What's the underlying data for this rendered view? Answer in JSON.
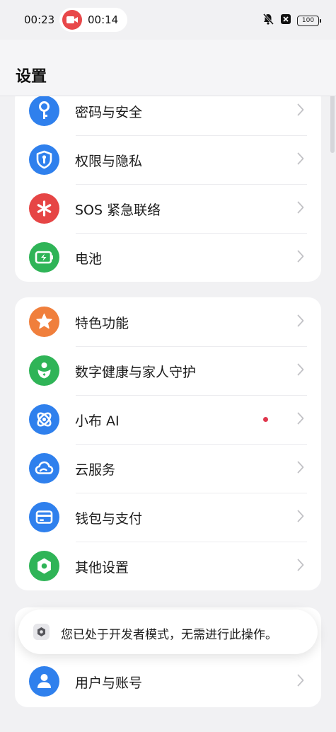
{
  "status_bar": {
    "time": "00:23",
    "recording_time": "00:14",
    "battery": "100"
  },
  "header": {
    "title": "设置"
  },
  "section1": {
    "items": [
      {
        "label": "密码与安全",
        "icon": "key-icon",
        "color": "#2f80ed"
      },
      {
        "label": "权限与隐私",
        "icon": "shield-icon",
        "color": "#2f80ed"
      },
      {
        "label": "SOS 紧急联络",
        "icon": "asterisk-icon",
        "color": "#e64545"
      },
      {
        "label": "电池",
        "icon": "battery-icon",
        "color": "#2fb457"
      }
    ]
  },
  "section2": {
    "items": [
      {
        "label": "特色功能",
        "icon": "star-icon",
        "color": "#f07f3c"
      },
      {
        "label": "数字健康与家人守护",
        "icon": "family-icon",
        "color": "#2fb457"
      },
      {
        "label": "小布 AI",
        "icon": "xiaobu-ai-icon",
        "color": "#2f80ed",
        "has_badge": true
      },
      {
        "label": "云服务",
        "icon": "cloud-icon",
        "color": "#2f80ed"
      },
      {
        "label": "钱包与支付",
        "icon": "wallet-icon",
        "color": "#2f80ed"
      },
      {
        "label": "其他设置",
        "icon": "gear-icon",
        "color": "#2fb457"
      }
    ]
  },
  "section3": {
    "items": [
      {
        "label": "用户与账号",
        "icon": "user-icon",
        "color": "#2f80ed"
      }
    ]
  },
  "toast": {
    "text": "您已处于开发者模式，无需进行此操作。"
  },
  "colors": {
    "badge": "#e0374d",
    "recording": "#e8484a"
  }
}
